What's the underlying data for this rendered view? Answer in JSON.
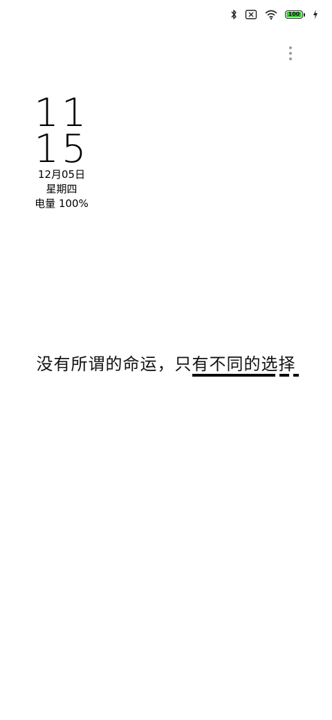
{
  "status_bar": {
    "battery_level": "100",
    "battery_color": "#3ecf3e"
  },
  "clock": {
    "hour": "11",
    "minute": "15",
    "date": "12月05日",
    "weekday": "星期四",
    "battery_text": "电量 100%"
  },
  "quote": {
    "text": "没有所谓的命运，只有不同的选择"
  },
  "icons": [
    "bluetooth-icon",
    "no-sim-icon",
    "wifi-icon",
    "battery-icon",
    "charging-icon",
    "more-vertical-icon"
  ]
}
